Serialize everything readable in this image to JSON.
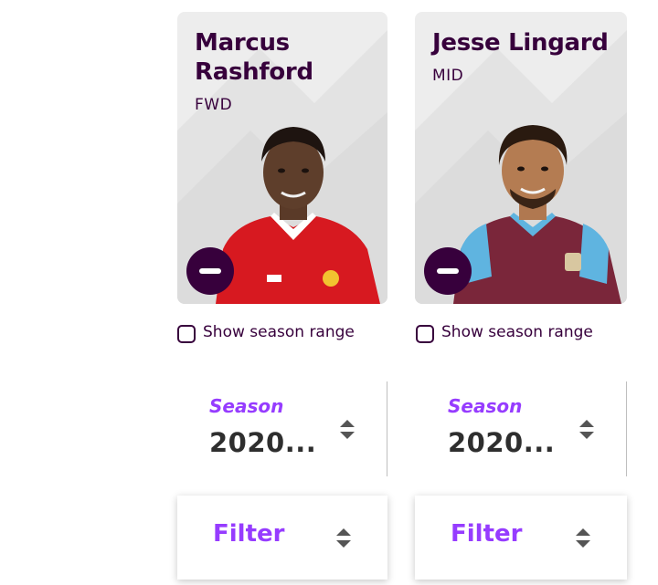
{
  "players": [
    {
      "name": "Marcus Rashford",
      "name_line1": "Marcus",
      "name_line2": "Rashford",
      "position": "FWD",
      "remove_icon": "minus-icon",
      "season_range_label": "Show season range",
      "season_title": "Season",
      "season_value": "2020...",
      "filter_label": "Filter",
      "kit_color": "#d71920"
    },
    {
      "name": "Jesse Lingard",
      "position": "MID",
      "remove_icon": "minus-icon",
      "season_range_label": "Show season range",
      "season_title": "Season",
      "season_value": "2020...",
      "filter_label": "Filter",
      "kit_color": "#7a263a"
    }
  ],
  "colors": {
    "brand": "#37003c",
    "accent": "#963cff",
    "card_bg": "#ededed"
  }
}
